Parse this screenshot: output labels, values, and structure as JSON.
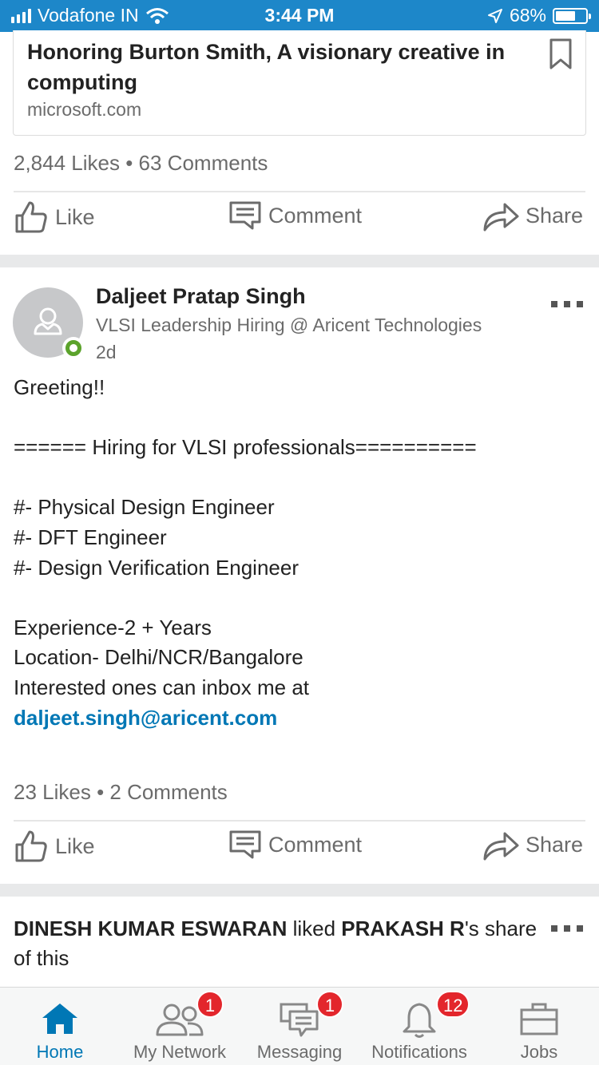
{
  "status_bar": {
    "carrier": "Vodafone IN",
    "time": "3:44 PM",
    "battery": "68%",
    "battery_level": 0.68
  },
  "shared_article": {
    "title": "Honoring Burton Smith, A visionary creative in computing",
    "source": "microsoft.com",
    "likes_comments": "2,844 Likes • 63 Comments"
  },
  "actions": {
    "like": "Like",
    "comment": "Comment",
    "share": "Share"
  },
  "post": {
    "author_name": "Daljeet Pratap Singh",
    "author_headline": "VLSI Leadership Hiring @ Aricent Technologies",
    "time": "2d",
    "body_lines": [
      "Greeting!!",
      "",
      "====== Hiring for VLSI professionals==========",
      "",
      "#- Physical Design Engineer",
      "#- DFT Engineer",
      "#- Design Verification Engineer",
      "",
      "Experience-2 + Years",
      "Location- Delhi/NCR/Bangalore",
      "Interested ones can inbox me at"
    ],
    "email_link": "daljeet.singh@aricent.com",
    "likes_comments": "23 Likes • 2 Comments"
  },
  "activity": {
    "actor": "DINESH KUMAR ESWARAN",
    "verb": " liked ",
    "subject": "PRAKASH R",
    "tail": "'s share of this"
  },
  "bottom_nav": [
    {
      "label": "Home",
      "icon": "home-icon",
      "badge": "",
      "active": true
    },
    {
      "label": "My Network",
      "icon": "network-icon",
      "badge": "1",
      "active": false
    },
    {
      "label": "Messaging",
      "icon": "messaging-icon",
      "badge": "1",
      "active": false
    },
    {
      "label": "Notifications",
      "icon": "bell-icon",
      "badge": "12",
      "active": false
    },
    {
      "label": "Jobs",
      "icon": "briefcase-icon",
      "badge": "",
      "active": false
    }
  ],
  "colors": {
    "status_bar": "#1d87c9",
    "link": "#0077b5",
    "badge": "#e3262c",
    "presence": "#5ba32b"
  }
}
